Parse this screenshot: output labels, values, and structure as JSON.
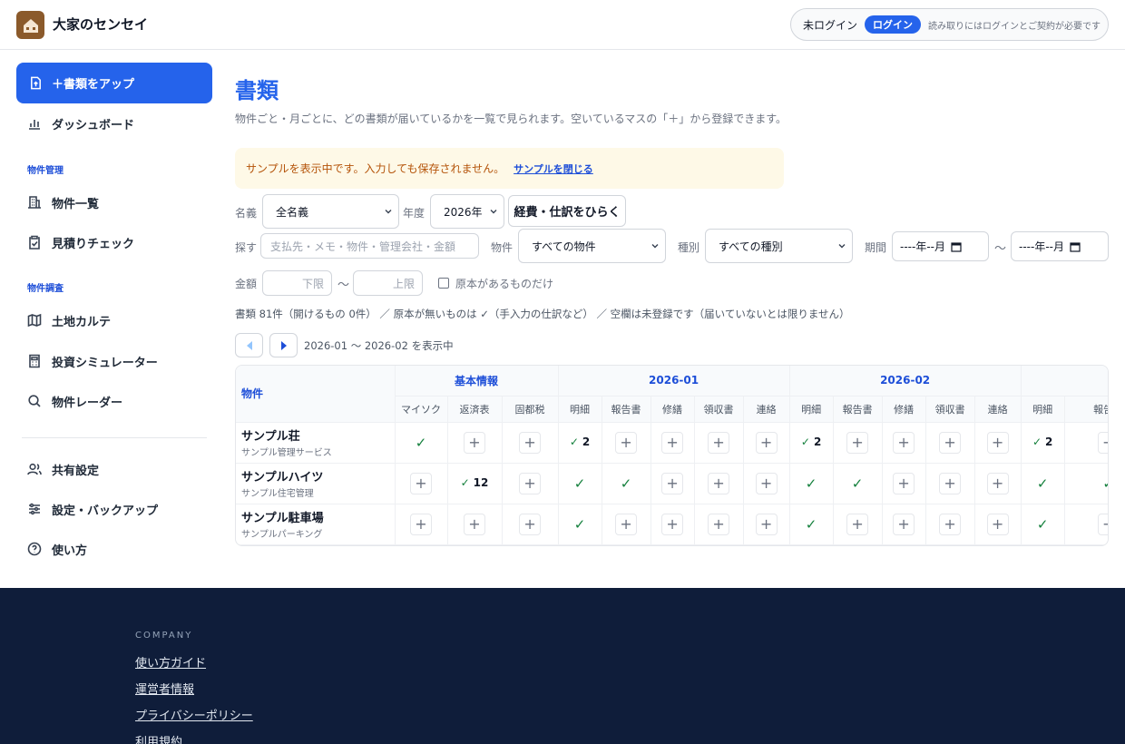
{
  "header": {
    "app_title": "大家のセンセイ",
    "login_status": "未ログイン",
    "login_button": "ログイン",
    "login_note": "読み取りにはログインとご契約が必要です"
  },
  "sidebar": {
    "upload_button": "＋書類をアップ",
    "items": [
      {
        "label": "ダッシュボード",
        "icon": "bar-chart-icon"
      },
      {
        "label": "物件一覧",
        "icon": "building-icon"
      },
      {
        "label": "見積りチェック",
        "icon": "clipboard-check-icon"
      },
      {
        "label": "土地カルテ",
        "icon": "map-icon"
      },
      {
        "label": "投資シミュレーター",
        "icon": "calculator-icon"
      },
      {
        "label": "物件レーダー",
        "icon": "search-icon"
      },
      {
        "label": "共有設定",
        "icon": "users-icon"
      },
      {
        "label": "設定・バックアップ",
        "icon": "sliders-icon"
      },
      {
        "label": "使い方",
        "icon": "help-circle-icon"
      }
    ],
    "sections": [
      "物件管理",
      "物件調査"
    ]
  },
  "main": {
    "title": "書類",
    "description": "物件ごと・月ごとに、どの書類が届いているかを一覧で見られます。空いているマスの「＋」から登録できます。",
    "sample_banner": "サンプルを表示中です。入力しても保存されません。",
    "sample_close": "サンプルを閉じる"
  },
  "filters": {
    "owner_label": "名義",
    "owner_value": "全名義",
    "year_label": "年度",
    "year_value": "2026年",
    "expense_button": "経費・仕訳をひらく",
    "search_label": "探す",
    "search_placeholder": "支払先・メモ・物件・管理会社・金額",
    "property_label": "物件",
    "property_value": "すべての物件",
    "type_label": "種別",
    "type_value": "すべての種別",
    "period_label": "期間",
    "date_placeholder": "----年--月",
    "tilde": "〜",
    "amount_label": "金額",
    "amount_min_placeholder": "下限",
    "amount_max_placeholder": "上限",
    "original_only_label": "原本があるものだけ",
    "original_only_checked": false
  },
  "summary": "書類 81件（開けるもの 0件） ／ 原本が無いものは ✓（手入力の仕訳など） ／ 空欄は未登録です（届いていないとは限りません）",
  "pager": {
    "range_text": "2026-01 〜 2026-02 を表示中"
  },
  "grid": {
    "property_header": "物件",
    "groups": [
      {
        "label": "基本情報",
        "columns": [
          "マイソク",
          "返済表",
          "固都税"
        ]
      },
      {
        "label": "2026-01",
        "columns": [
          "明細",
          "報告書",
          "修繕",
          "領収書",
          "連絡"
        ]
      },
      {
        "label": "2026-02",
        "columns": [
          "明細",
          "報告書",
          "修繕",
          "領収書",
          "連絡"
        ]
      },
      {
        "label": "",
        "columns": [
          "明細",
          "報告書"
        ]
      }
    ],
    "rows": [
      {
        "name": "サンプル荘",
        "manager": "サンプル管理サービス",
        "cells": [
          "check",
          "plus",
          "plus",
          "check:2",
          "plus",
          "plus",
          "plus",
          "plus",
          "check:2",
          "plus",
          "plus",
          "plus",
          "plus",
          "check:2",
          "plus"
        ]
      },
      {
        "name": "サンプルハイツ",
        "manager": "サンプル住宅管理",
        "cells": [
          "plus",
          "check:12",
          "plus",
          "check",
          "check",
          "plus",
          "plus",
          "plus",
          "check",
          "check",
          "plus",
          "plus",
          "plus",
          "check",
          "check"
        ]
      },
      {
        "name": "サンプル駐車場",
        "manager": "サンプルパーキング",
        "cells": [
          "plus",
          "plus",
          "plus",
          "check",
          "plus",
          "plus",
          "plus",
          "plus",
          "check",
          "plus",
          "plus",
          "plus",
          "plus",
          "check",
          "plus"
        ]
      }
    ]
  },
  "footer": {
    "heading": "COMPANY",
    "links": [
      "使い方ガイド",
      "運営者情報",
      "プライバシーポリシー",
      "利用規約"
    ]
  },
  "colors": {
    "accent": "#2563eb",
    "footer_bg": "#0f1d3a",
    "check": "#15803d",
    "banner_bg": "#fef9e7"
  }
}
